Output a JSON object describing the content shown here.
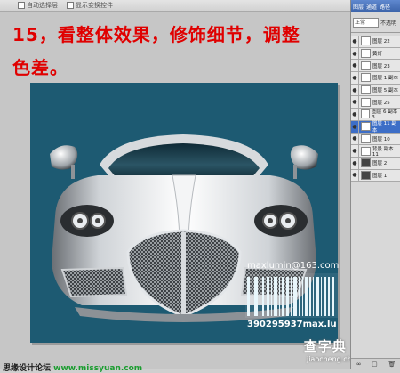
{
  "toolbar": {
    "options": [
      "自动选择层",
      "显示变换控件"
    ]
  },
  "headline": {
    "line1": "15，看整体效果，修饰细节，调整",
    "line2": "色差。"
  },
  "canvas": {
    "background": "#1d5a72",
    "email": "maxlumin@163.com",
    "barcode_number": "390295937max.lu"
  },
  "footer": {
    "site_prefix": "思缘设计论坛 ",
    "site_link": "www.missyuan.com",
    "brand_cn": "查字典 教程网",
    "brand_url": "jiaocheng.chazidian.com"
  },
  "layers_panel": {
    "tabs": [
      "图层",
      "通道",
      "路径"
    ],
    "blend_mode": "正常",
    "opacity_label": "不透明",
    "layers": [
      {
        "name": "图层 22",
        "selected": false
      },
      {
        "name": "黄灯",
        "selected": false
      },
      {
        "name": "图层 23",
        "selected": false
      },
      {
        "name": "图层 1 副本",
        "selected": false
      },
      {
        "name": "图层 5 副本",
        "selected": false
      },
      {
        "name": "图层 25",
        "selected": false
      },
      {
        "name": "图层 6 副本 3",
        "selected": false
      },
      {
        "name": "图层 11 副本",
        "selected": true
      },
      {
        "name": "图层 10",
        "selected": false
      },
      {
        "name": "背景 副本 11",
        "selected": false
      },
      {
        "name": "图层 2",
        "selected": false
      },
      {
        "name": "图层 1",
        "selected": false
      }
    ]
  }
}
